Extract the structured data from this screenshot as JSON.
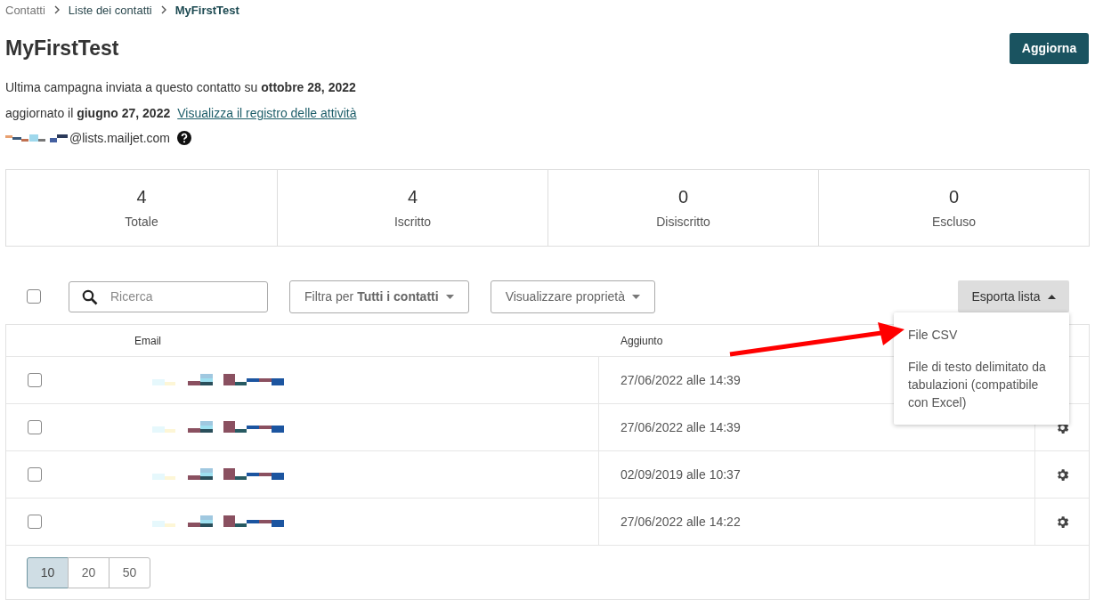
{
  "breadcrumb": [
    {
      "label": "Contatti",
      "current": false
    },
    {
      "label": "Liste dei contatti",
      "current": false
    },
    {
      "label": "MyFirstTest",
      "current": true
    }
  ],
  "title": "MyFirstTest",
  "update_button": "Aggiorna",
  "info": {
    "last_campaign": "Ultima campagna inviata a questo contatto su **ottobre 28, 2022**",
    "updated": "aggiornato il **giugno 27, 2022**",
    "activity_link": "Visualizza il registro delle attività",
    "address_suffix": "@lists.mailjet.com"
  },
  "stats": [
    {
      "value": "4",
      "label": "Totale"
    },
    {
      "value": "4",
      "label": "Iscritto"
    },
    {
      "value": "0",
      "label": "Disiscritto"
    },
    {
      "value": "0",
      "label": "Escluso"
    }
  ],
  "toolbar": {
    "select_all_checked": false,
    "search_placeholder": "Ricerca",
    "filter": "Filtra per **Tutti i contatti**",
    "properties": "Visualizzare proprietà",
    "export": "Esporta lista",
    "export_expanded": true
  },
  "export_menu": [
    "File CSV",
    "File di testo delimitato da tabulazioni (compatibile con Excel)"
  ],
  "table": {
    "columns": [
      "Email",
      "Aggiunto"
    ],
    "rows": [
      {
        "checked": false,
        "added": "27/06/2022 alle 14:39"
      },
      {
        "checked": false,
        "added": "27/06/2022 alle 14:39"
      },
      {
        "checked": false,
        "added": "02/09/2019 alle 10:37"
      },
      {
        "checked": false,
        "added": "27/06/2022 alle 14:22"
      }
    ]
  },
  "page_sizes": [
    {
      "label": "10",
      "selected": true
    },
    {
      "label": "20",
      "selected": false
    },
    {
      "label": "50",
      "selected": false
    }
  ]
}
